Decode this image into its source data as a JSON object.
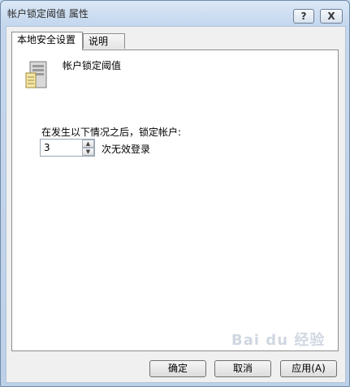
{
  "window": {
    "title": "帐户锁定阈值 属性",
    "help_label": "?",
    "close_label": "X"
  },
  "tabs": [
    {
      "label": "本地安全设置",
      "active": true
    },
    {
      "label": "说明",
      "active": false
    }
  ],
  "policy": {
    "icon": "server-policy-icon",
    "title": "帐户锁定阈值"
  },
  "lockout": {
    "description": "在发生以下情况之后，锁定帐户:",
    "value": "3",
    "unit": "次无效登录"
  },
  "buttons": {
    "ok": "确定",
    "cancel": "取消",
    "apply": "应用(A)"
  },
  "watermark": "Bai du 经验"
}
